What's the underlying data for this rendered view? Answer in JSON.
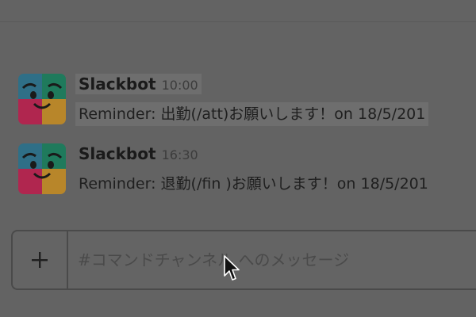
{
  "messages": [
    {
      "sender": "Slackbot",
      "time": "10:00",
      "text": "Reminder: 出勤(/att)お願いします！on 18/5/201"
    },
    {
      "sender": "Slackbot",
      "time": "16:30",
      "text": "Reminder: 退勤(/fin )お願いします！on 18/5/201"
    }
  ],
  "composer": {
    "add_label": "+",
    "placeholder": "#コマンドチャンネル へのメッセージ"
  },
  "colors": {
    "background": "#636363",
    "avatar_blue": "#2f6f87",
    "avatar_green": "#1f7a5c",
    "avatar_red": "#b0264f",
    "avatar_yellow": "#b8862a"
  },
  "icons": {
    "avatar": "slackbot-avatar-icon",
    "add": "plus-icon",
    "cursor": "mouse-pointer-icon"
  }
}
